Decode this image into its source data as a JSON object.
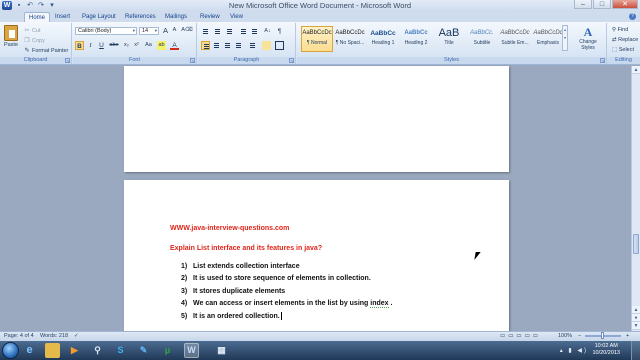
{
  "window": {
    "title": "New Microsoft Office Word Document - Microsoft Word",
    "app_logo_letter": "W",
    "controls": {
      "minimize": "–",
      "maximize": "□",
      "close": "✕"
    }
  },
  "tabs": [
    "Home",
    "Insert",
    "Page Layout",
    "References",
    "Mailings",
    "Review",
    "View"
  ],
  "active_tab": "Home",
  "ribbon": {
    "clipboard": {
      "label": "Clipboard",
      "paste": "Paste",
      "cut": "Cut",
      "copy": "Copy",
      "format_painter": "Format Painter"
    },
    "font": {
      "label": "Font",
      "name": "Calibri (Body)",
      "size": "14",
      "buttons": {
        "bold": "B",
        "italic": "I",
        "underline": "U",
        "strike": "abe",
        "subscript": "x₂",
        "superscript": "x²",
        "change_case": "Aa",
        "grow": "A",
        "shrink": "A",
        "highlight": "ab",
        "font_color": "A"
      }
    },
    "paragraph": {
      "label": "Paragraph",
      "pilcrow": "¶"
    },
    "styles": {
      "label": "Styles",
      "items": [
        {
          "sample": "AaBbCcDc",
          "name": "¶ Normal"
        },
        {
          "sample": "AaBbCcDc",
          "name": "¶ No Spaci..."
        },
        {
          "sample": "AaBbCc",
          "name": "Heading 1"
        },
        {
          "sample": "AaBbCc",
          "name": "Heading 2"
        },
        {
          "sample": "AaB",
          "name": "Title"
        },
        {
          "sample": "AaBbCc.",
          "name": "Subtitle"
        },
        {
          "sample": "AaBbCcDc",
          "name": "Subtle Em..."
        },
        {
          "sample": "AaBbCcDc",
          "name": "Emphasis"
        }
      ],
      "change_styles": "Change Styles",
      "change_styles_icon": "A"
    },
    "editing": {
      "label": "Editing",
      "find": "Find",
      "replace": "Replace",
      "select": "Select"
    }
  },
  "document": {
    "website": "WWW.java-interview-questions.com",
    "heading": "Explain List interface and its features in java?",
    "items": [
      {
        "num": "1)",
        "text": "List extends collection interface"
      },
      {
        "num": "2)",
        "text": "It is used to store sequence of elements in collection."
      },
      {
        "num": "3)",
        "text": "It stores duplicate elements"
      },
      {
        "num": "4)",
        "text": "We can access or insert elements in the list by using ",
        "spell": "index",
        "after": " ."
      },
      {
        "num": "5)",
        "text": "It is an ordered collection."
      }
    ]
  },
  "status_bar": {
    "page": "Page: 4 of 4",
    "words": "Words: 218",
    "zoom": "100%"
  },
  "taskbar": {
    "icons": [
      "internet-explorer",
      "folder",
      "media-player",
      "search",
      "skype",
      "paint",
      "torrent",
      "word",
      "task-manager"
    ],
    "clock_time": "10:02 AM",
    "clock_date": "10/20/2013"
  }
}
